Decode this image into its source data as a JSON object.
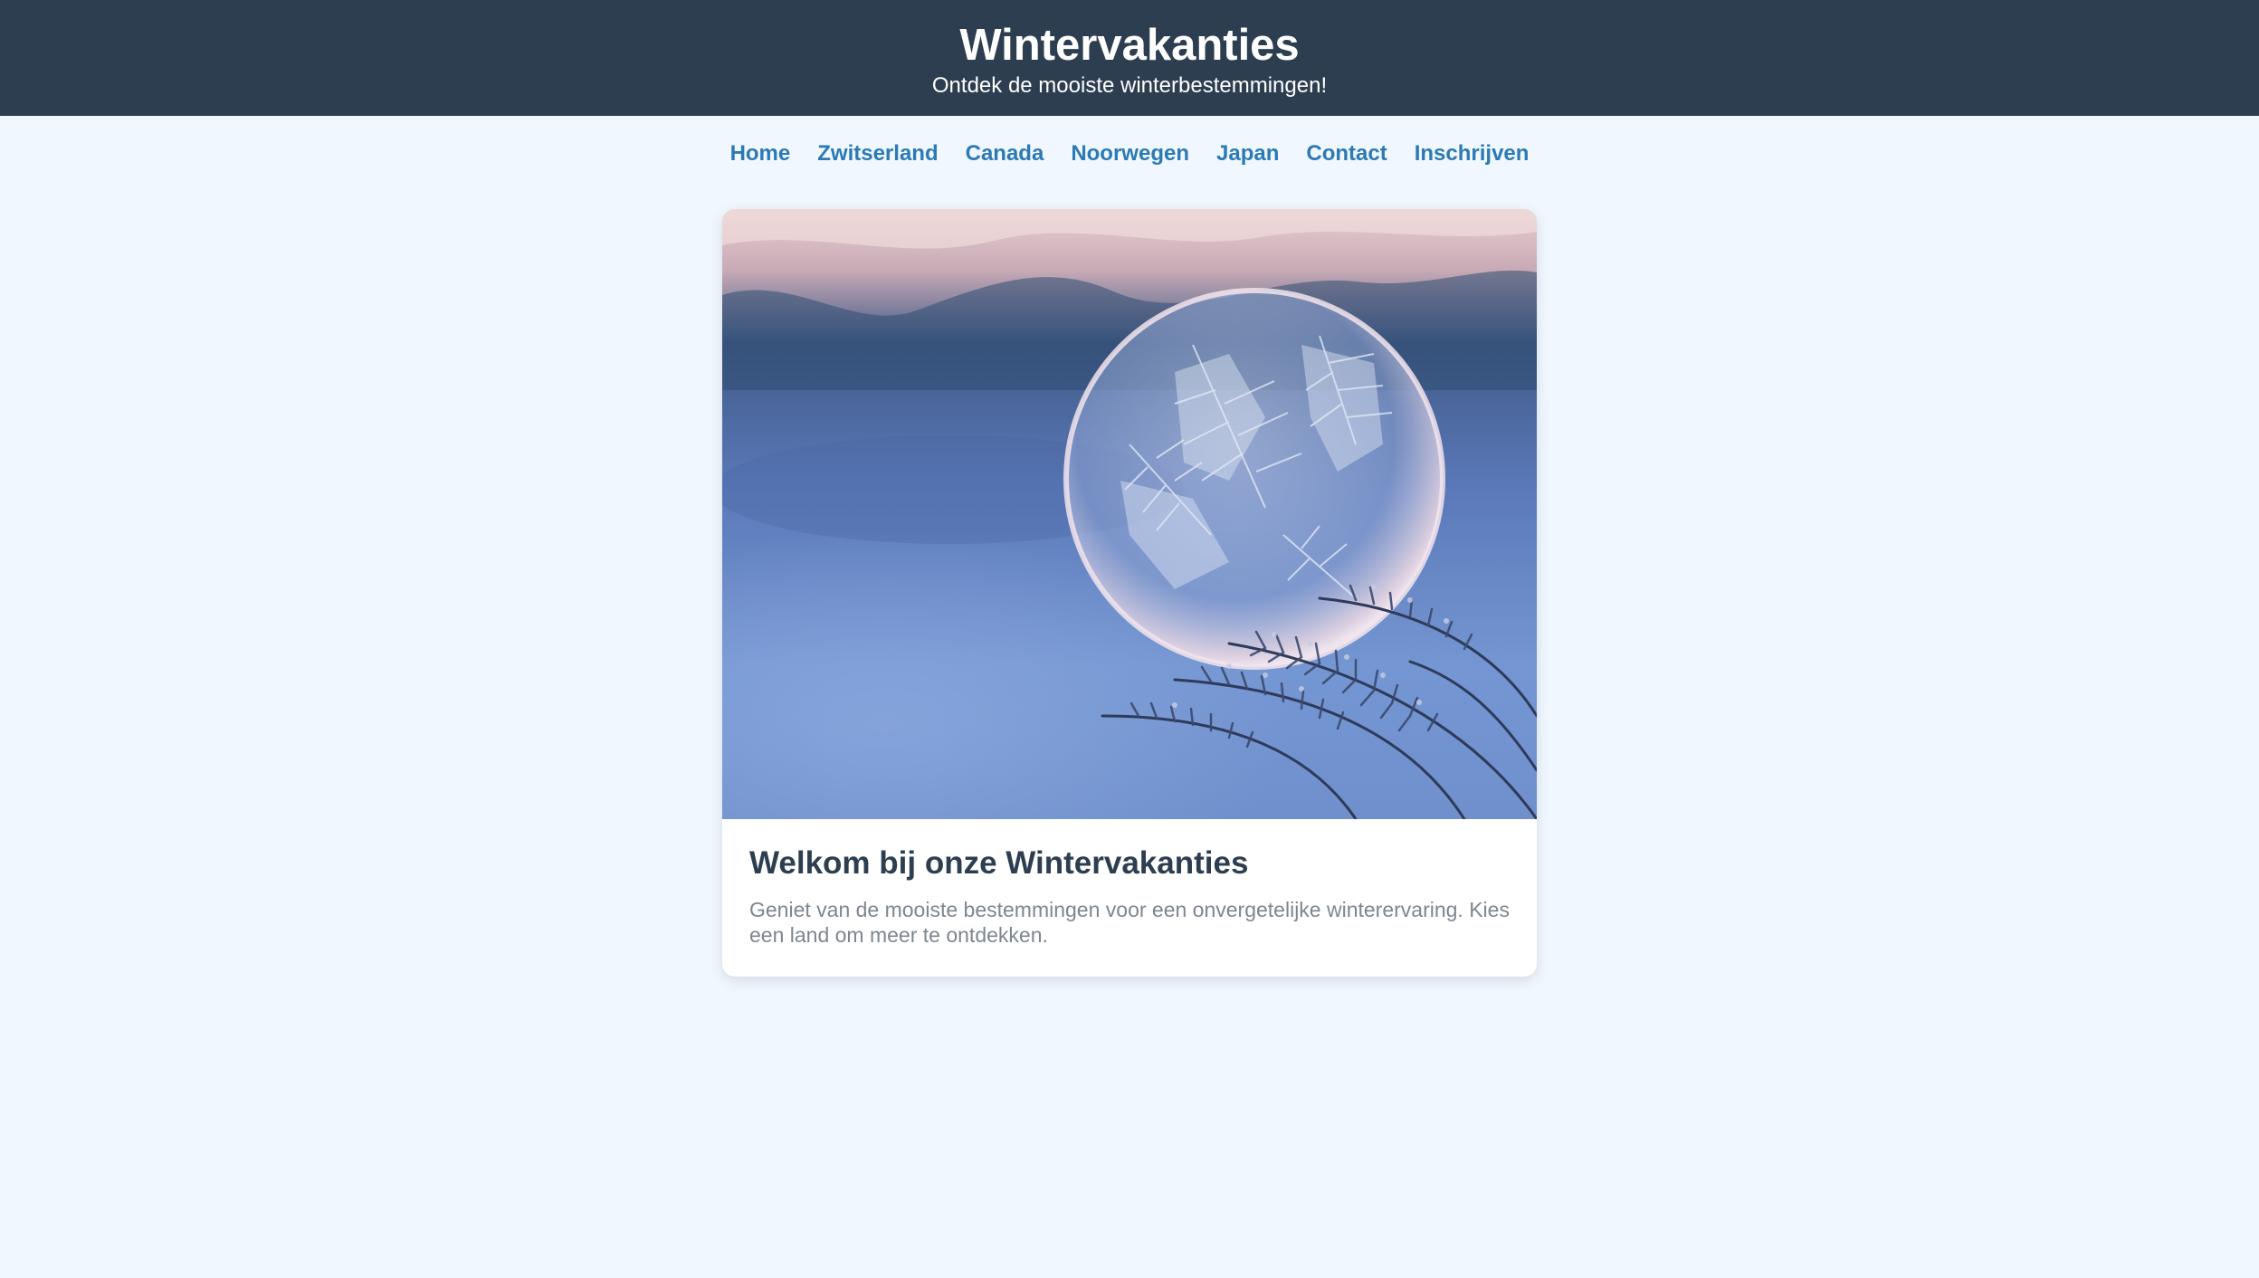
{
  "header": {
    "title": "Wintervakanties",
    "subtitle": "Ontdek de mooiste winterbestemmingen!"
  },
  "nav": {
    "items": [
      {
        "label": "Home"
      },
      {
        "label": "Zwitserland"
      },
      {
        "label": "Canada"
      },
      {
        "label": "Noorwegen"
      },
      {
        "label": "Japan"
      },
      {
        "label": "Contact"
      },
      {
        "label": "Inschrijven"
      }
    ]
  },
  "card": {
    "image_alt": "frozen-soap-bubble-photo",
    "title": "Welkom bij onze Wintervakanties",
    "text": "Geniet van de mooiste bestemmingen voor een onvergetelijke winterervaring. Kies een land om meer te ontdekken."
  },
  "colors": {
    "header_bg": "#2c3e50",
    "page_bg": "#f0f7fe",
    "link": "#2c7ab5",
    "heading": "#2c3e50",
    "body_text": "#7d8690"
  }
}
